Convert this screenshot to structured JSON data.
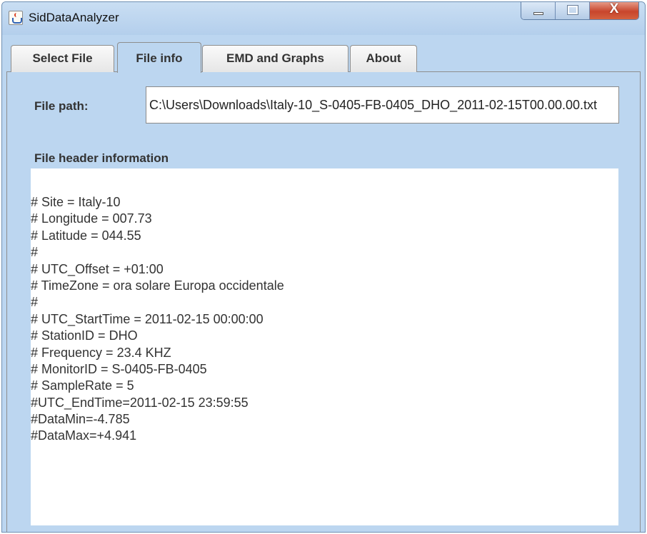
{
  "window": {
    "title": "SidDataAnalyzer",
    "controls": {
      "close_glyph": "X"
    }
  },
  "tabs": [
    {
      "label": "Select File",
      "active": false
    },
    {
      "label": "File info",
      "active": true
    },
    {
      "label": "EMD and Graphs",
      "active": false
    },
    {
      "label": "About",
      "active": false
    }
  ],
  "file_info": {
    "file_path_label": "File path:",
    "file_path_value": "C:\\Users\\Downloads\\Italy-10_S-0405-FB-0405_DHO_2011-02-15T00.00.00.txt",
    "header_label": "File header information",
    "header_lines": [
      "# Site = Italy-10",
      "# Longitude = 007.73",
      "# Latitude = 044.55",
      "#",
      "# UTC_Offset = +01:00",
      "# TimeZone = ora solare Europa occidentale",
      "#",
      "# UTC_StartTime = 2011-02-15 00:00:00",
      "# StationID = DHO",
      "# Frequency = 23.4 KHZ",
      "# MonitorID = S-0405-FB-0405",
      "# SampleRate = 5",
      "#UTC_EndTime=2011-02-15 23:59:55",
      "#DataMin=-4.785",
      "#DataMax=+4.941"
    ]
  },
  "colors": {
    "panel_bg": "#bcd6f0",
    "close_button": "#c8452c"
  }
}
